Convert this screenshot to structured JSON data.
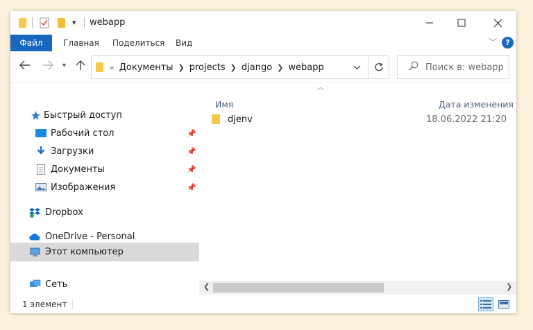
{
  "window": {
    "title": "webapp"
  },
  "ribbon": {
    "file_tab": "Файл",
    "tabs": [
      "Главная",
      "Поделиться",
      "Вид"
    ],
    "help_label": "?"
  },
  "address": {
    "overflow_label": "«",
    "crumbs": [
      "Документы",
      "projects",
      "django",
      "webapp"
    ]
  },
  "search": {
    "placeholder": "Поиск в: webapp"
  },
  "navpane": {
    "quick_access": "Быстрый доступ",
    "quick_items": [
      "Рабочий стол",
      "Загрузки",
      "Документы",
      "Изображения"
    ],
    "dropbox": "Dropbox",
    "onedrive": "OneDrive - Personal",
    "this_pc": "Этот компьютер",
    "network": "Сеть"
  },
  "content": {
    "columns": {
      "name": "Имя",
      "date_modified": "Дата изменения"
    },
    "files": [
      {
        "name": "djenv",
        "modified": "18.06.2022 21:20",
        "icon": "folder-icon"
      }
    ]
  },
  "status": {
    "item_count": "1 элемент"
  },
  "colors": {
    "accent": "#1a67c0",
    "folder": "#f6c84a",
    "selection": "#d9d9d9",
    "column_header": "#4c607a",
    "page_background": "#fcf1dc"
  }
}
